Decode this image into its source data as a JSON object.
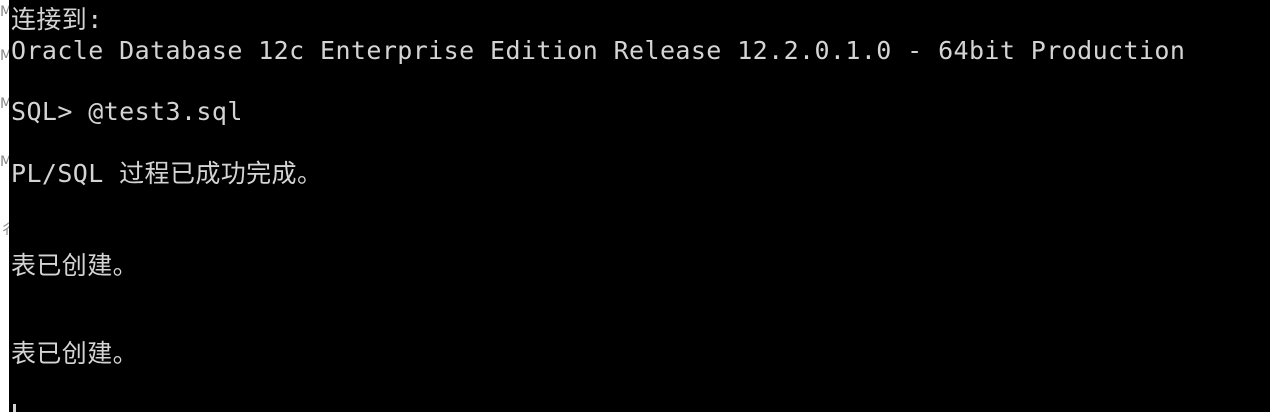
{
  "console": {
    "lines": [
      "连接到:",
      "Oracle Database 12c Enterprise Edition Release 12.2.0.1.0 - 64bit Production",
      "SQL> @test3.sql",
      "PL/SQL 过程已成功完成。",
      "表已创建。",
      "表已创建。"
    ]
  },
  "left_strip": {
    "glyphs": [
      "M",
      "M",
      "M",
      "M",
      "彳",
      "「"
    ]
  },
  "colors": {
    "background": "#000000",
    "text": "#d4d4d4",
    "strip": "#ffffff"
  }
}
